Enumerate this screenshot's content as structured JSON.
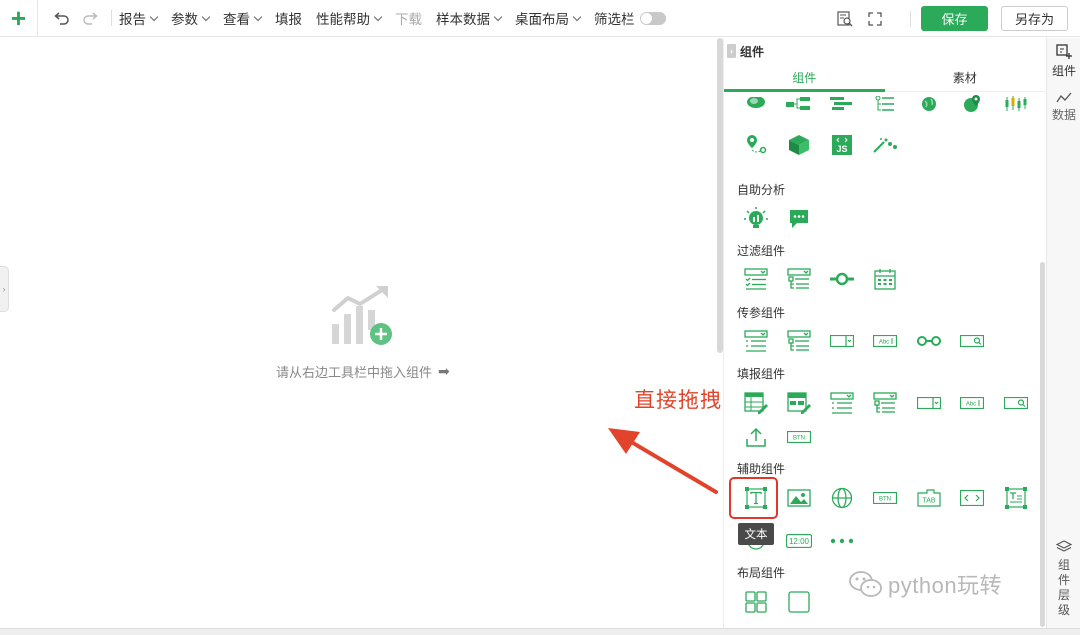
{
  "toolbar": {
    "undo_icon": "undo-icon",
    "redo_icon": "redo-icon",
    "menus": [
      {
        "label": "报告",
        "dropdown": true,
        "disabled": false
      },
      {
        "label": "参数",
        "dropdown": true,
        "disabled": false
      },
      {
        "label": "查看",
        "dropdown": true,
        "disabled": false
      },
      {
        "label": "填报",
        "dropdown": false,
        "disabled": false
      },
      {
        "label": "性能帮助",
        "dropdown": true,
        "disabled": false
      },
      {
        "label": "下载",
        "dropdown": false,
        "disabled": true
      },
      {
        "label": "样本数据",
        "dropdown": true,
        "disabled": false
      },
      {
        "label": "桌面布局",
        "dropdown": true,
        "disabled": false
      }
    ],
    "filter_bar_label": "筛选栏",
    "save_label": "保存",
    "save_as_label": "另存为"
  },
  "canvas": {
    "hint_text": "请从右边工具栏中拖入组件"
  },
  "annotation": {
    "text": "直接拖拽"
  },
  "panel": {
    "title": "组件",
    "tabs": [
      {
        "label": "组件",
        "active": true
      },
      {
        "label": "素材",
        "active": false
      }
    ],
    "sections": [
      {
        "title": "自助分析"
      },
      {
        "title": "过滤组件"
      },
      {
        "title": "传参组件"
      },
      {
        "title": "填报组件"
      },
      {
        "title": "辅助组件"
      },
      {
        "title": "布局组件"
      }
    ],
    "tooltip": "文本",
    "btn_icon_text": "BTN",
    "tab_icon_text": "TAB",
    "abc_icon_text": "Abc",
    "js_icon_text": "JS",
    "time_icon_text": "12:00"
  },
  "rail": {
    "components_label": "组件",
    "data_label": "数据",
    "layers_label": [
      "组",
      "件",
      "层",
      "级"
    ]
  },
  "watermark": {
    "text": "python玩转"
  },
  "colors": {
    "accent": "#2bab5a",
    "annotation": "#e1442a"
  }
}
